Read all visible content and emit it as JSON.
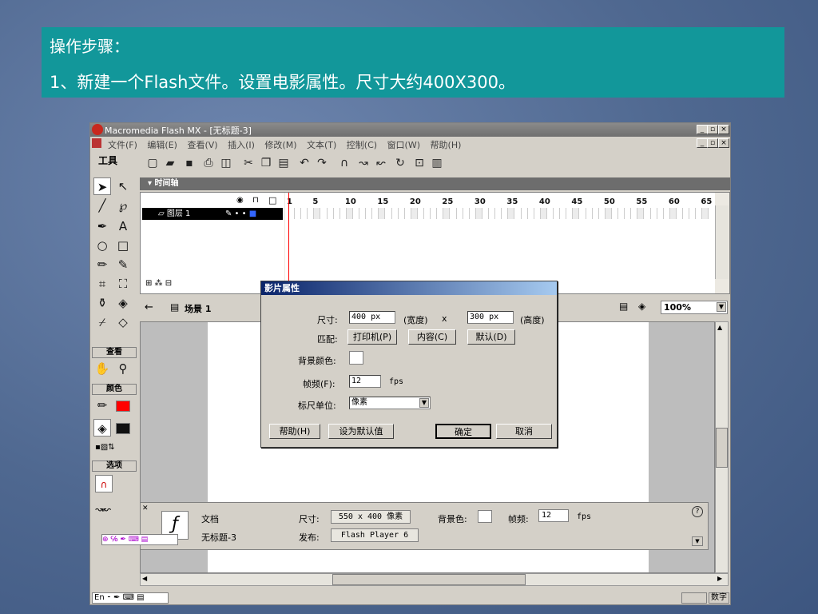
{
  "slide": {
    "heading": "操作步骤：",
    "step": "1、新建一个Flash文件。设置电影属性。尺寸大约400X300。"
  },
  "window": {
    "title": "Macromedia Flash MX - [无标题-3]",
    "menus": [
      "文件(F)",
      "编辑(E)",
      "查看(V)",
      "插入(I)",
      "修改(M)",
      "文本(T)",
      "控制(C)",
      "窗口(W)",
      "帮助(H)"
    ]
  },
  "tools": {
    "title": "工具",
    "view_label": "查看",
    "colors_label": "颜色",
    "options_label": "选项"
  },
  "timeline": {
    "title": "时间轴",
    "layer_name": "图层 1",
    "frame_numbers": [
      "1",
      "5",
      "10",
      "15",
      "20",
      "25",
      "30",
      "35",
      "40",
      "45",
      "50",
      "55",
      "60",
      "65"
    ]
  },
  "scene": {
    "name": "场景 1",
    "zoom": "100%"
  },
  "properties": {
    "doc_label": "文档",
    "doc_name": "无标题-3",
    "size_label": "尺寸:",
    "size_value": "550 x 400 像素",
    "bg_label": "背景色:",
    "fps_label": "帧频:",
    "fps_value": "12",
    "fps_unit": "fps",
    "publish_label": "发布:",
    "publish_value": "Flash Player 6",
    "help_glyph": "?"
  },
  "status": {
    "ime": "En",
    "mode": "数字"
  },
  "dialog": {
    "title": "影片属性",
    "size_label": "尺寸:",
    "width_value": "400 px",
    "width_label": "(宽度)",
    "times": "x",
    "height_value": "300 px",
    "height_label": "(高度)",
    "match_label": "匹配:",
    "match_printer": "打印机(P)",
    "match_contents": "内容(C)",
    "match_default": "默认(D)",
    "bg_label": "背景颜色:",
    "fps_label": "帧频(F):",
    "fps_value": "12",
    "fps_unit": "fps",
    "ruler_label": "标尺单位:",
    "ruler_value": "像素",
    "btn_help": "帮助(H)",
    "btn_set_default": "设为默认值",
    "btn_ok": "确定",
    "btn_cancel": "取消"
  },
  "colors": {
    "banner": "#12979a",
    "fill_swatch": "#ff0000",
    "dialog_title": "#0a246a"
  }
}
